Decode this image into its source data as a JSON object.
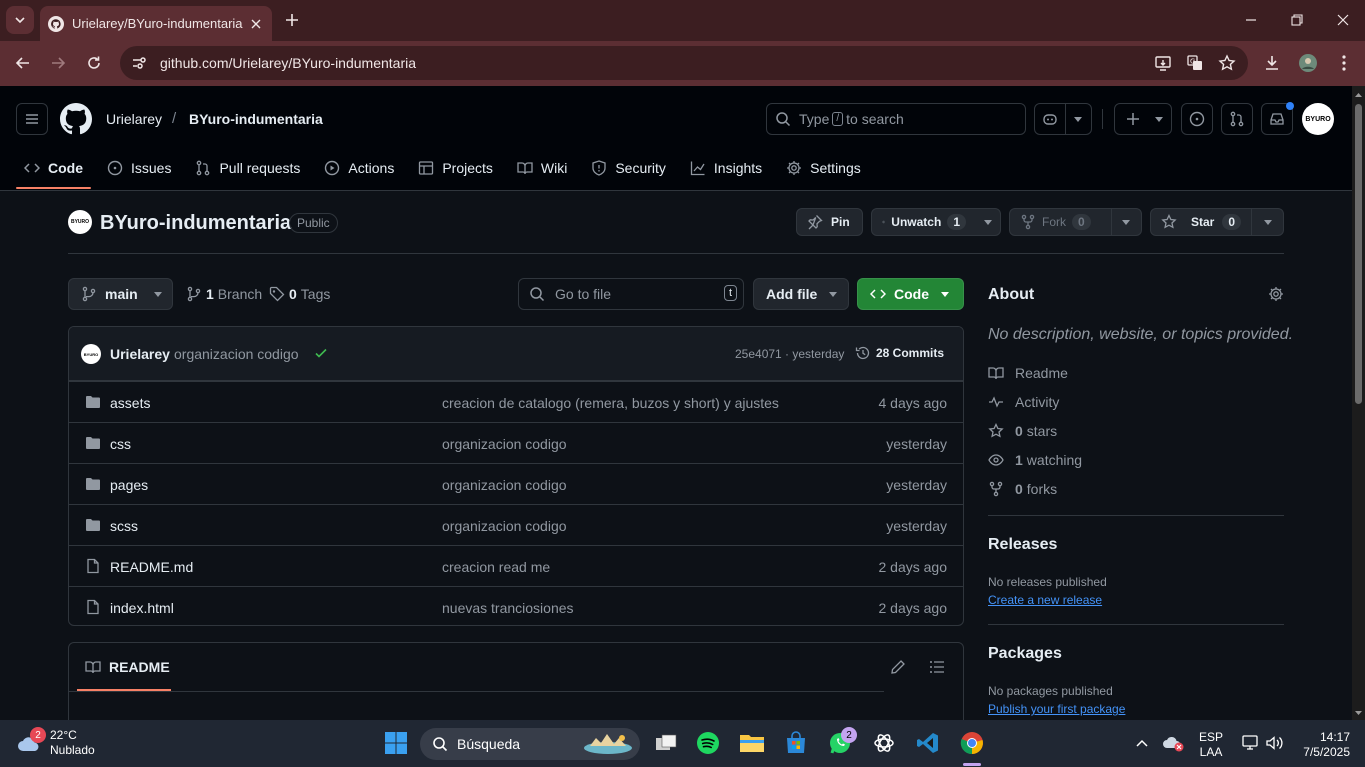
{
  "browser": {
    "tab_title": "Urielarey/BYuro-indumentaria",
    "url": "github.com/Urielarey/BYuro-indumentaria"
  },
  "header": {
    "owner": "Urielarey",
    "separator": "/",
    "repo": "BYuro-indumentaria",
    "search_prefix": "Type",
    "search_key": "/",
    "search_suffix": "to search",
    "avatar_text": "BYURO"
  },
  "repo_nav": [
    {
      "label": "Code",
      "icon": "code-icon",
      "active": true
    },
    {
      "label": "Issues",
      "icon": "issue-icon"
    },
    {
      "label": "Pull requests",
      "icon": "pull-request-icon"
    },
    {
      "label": "Actions",
      "icon": "play-icon"
    },
    {
      "label": "Projects",
      "icon": "table-icon"
    },
    {
      "label": "Wiki",
      "icon": "book-icon"
    },
    {
      "label": "Security",
      "icon": "shield-icon"
    },
    {
      "label": "Insights",
      "icon": "graph-icon"
    },
    {
      "label": "Settings",
      "icon": "gear-icon"
    }
  ],
  "repo": {
    "name": "BYuro-indumentaria",
    "visibility": "Public",
    "avatar_text": "BYURO",
    "pin_label": "Pin",
    "unwatch_label": "Unwatch",
    "watch_count": "1",
    "fork_label": "Fork",
    "fork_count": "0",
    "star_label": "Star",
    "star_count": "0"
  },
  "branch_bar": {
    "branch": "main",
    "branches_count": "1",
    "branches_label": "Branch",
    "tags_count": "0",
    "tags_label": "Tags",
    "go_to_file_placeholder": "Go to file",
    "go_to_file_key": "t",
    "add_file_label": "Add file",
    "code_label": "Code"
  },
  "latest_commit": {
    "author": "Urielarey",
    "message": "organizacion codigo",
    "sha_time": "25e4071 · yesterday",
    "commits_label": "28 Commits"
  },
  "files": [
    {
      "type": "folder",
      "name": "assets",
      "message": "creacion de catalogo (remera, buzos y short) y ajustes",
      "date": "4 days ago"
    },
    {
      "type": "folder",
      "name": "css",
      "message": "organizacion codigo",
      "date": "yesterday"
    },
    {
      "type": "folder",
      "name": "pages",
      "message": "organizacion codigo",
      "date": "yesterday"
    },
    {
      "type": "folder",
      "name": "scss",
      "message": "organizacion codigo",
      "date": "yesterday"
    },
    {
      "type": "file",
      "name": "README.md",
      "message": "creacion read me",
      "date": "2 days ago"
    },
    {
      "type": "file",
      "name": "index.html",
      "message": "nuevas tranciosiones",
      "date": "2 days ago"
    }
  ],
  "readme": {
    "tab_label": "README"
  },
  "about": {
    "title": "About",
    "description": "No description, website, or topics provided.",
    "readme_label": "Readme",
    "activity_label": "Activity",
    "stars_count": "0",
    "stars_label": "stars",
    "watching_count": "1",
    "watching_label": "watching",
    "forks_count": "0",
    "forks_label": "forks"
  },
  "releases": {
    "title": "Releases",
    "empty_text": "No releases published",
    "create_link": "Create a new release"
  },
  "packages": {
    "title": "Packages",
    "empty_text": "No packages published",
    "publish_link": "Publish your first package"
  },
  "taskbar": {
    "temperature": "22°C",
    "weather": "Nublado",
    "weather_badge": "2",
    "search_label": "Búsqueda",
    "whatsapp_badge": "2",
    "lang_top": "ESP",
    "lang_bottom": "LAA",
    "time": "14:17",
    "date": "7/5/2025"
  },
  "colors": {
    "chrome_frame": "#3c1e21",
    "chrome_toolbar": "#5c2e33",
    "gh_bg": "#0d1117",
    "gh_header": "#010409",
    "accent_underline": "#f78166",
    "code_button": "#238636",
    "link": "#4493f8"
  }
}
